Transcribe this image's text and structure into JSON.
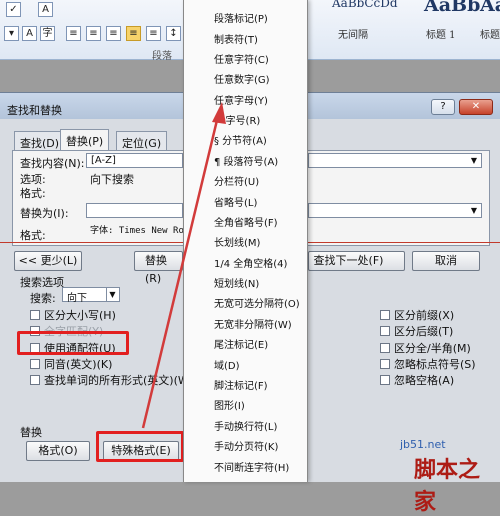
{
  "ribbon": {
    "styles": [
      {
        "sample": "AaBbCcDd",
        "name": "无间隔"
      },
      {
        "sample": "AaBb",
        "name": "标题 1"
      },
      {
        "sample": "AaBbC",
        "name": "标题"
      }
    ],
    "group_paragraph": "段落",
    "icons": [
      "check",
      "A",
      "align-left",
      "align-center",
      "align-right",
      "justify",
      "distributed",
      "paragraph-marks",
      "dropdown"
    ]
  },
  "dialog": {
    "title": "查找和替换",
    "help": "?",
    "close": "✕",
    "tabs": [
      "查找(D)",
      "替换(P)",
      "定位(G)"
    ],
    "find_label": "查找内容(N):",
    "find_value": "[A-Z]",
    "options_label": "选项:",
    "options_value": "向下搜索",
    "format_label": "格式:",
    "replace_label": "替换为(I):",
    "replace_value": "",
    "replace_format_label": "格式:",
    "replace_format_value": "字体: Times New Ro",
    "less_button": "<< 更少(L)",
    "replace_button": "替换(R)",
    "find_next_button": "查找下一处(F)",
    "cancel_button": "取消",
    "search_options_heading": "搜索选项",
    "search_label": "搜索:",
    "search_value": "向下",
    "checkboxes_left": [
      {
        "label": "区分大小写(H)",
        "dim": false
      },
      {
        "label": "全字匹配(Y)",
        "dim": true
      },
      {
        "label": "使用通配符(U)",
        "dim": false
      },
      {
        "label": "同音(英文)(K)",
        "dim": false
      },
      {
        "label": "查找单词的所有形式(英文)(W)",
        "dim": false
      }
    ],
    "checkboxes_right": [
      {
        "label": "区分前缀(X)"
      },
      {
        "label": "区分后缀(T)"
      },
      {
        "label": "区分全/半角(M)"
      },
      {
        "label": "忽略标点符号(S)"
      },
      {
        "label": "忽略空格(A)"
      }
    ],
    "replace_section": "替换",
    "format_button": "格式(O)",
    "special_button": "特殊格式(E)"
  },
  "special_menu": [
    "段落标记(P)",
    "制表符(T)",
    "任意字符(C)",
    "任意数字(G)",
    "任意字母(Y)",
    "^ 字号(R)",
    "§ 分节符(A)",
    "¶ 段落符号(A)",
    "分栏符(U)",
    "省略号(L)",
    "全角省略号(F)",
    "长划线(M)",
    "1/4 全角空格(4)",
    "短划线(N)",
    "无宽可选分隔符(O)",
    "无宽非分隔符(W)",
    "尾注标记(E)",
    "域(D)",
    "脚注标记(F)",
    "图形(I)",
    "手动换行符(L)",
    "手动分页符(K)",
    "不间断连字符(H)"
  ],
  "watermark": {
    "site": "jb51.net",
    "brand": "脚本之家"
  },
  "colors": {
    "highlight": "#e21f1f",
    "arrow": "#d23b3b"
  }
}
